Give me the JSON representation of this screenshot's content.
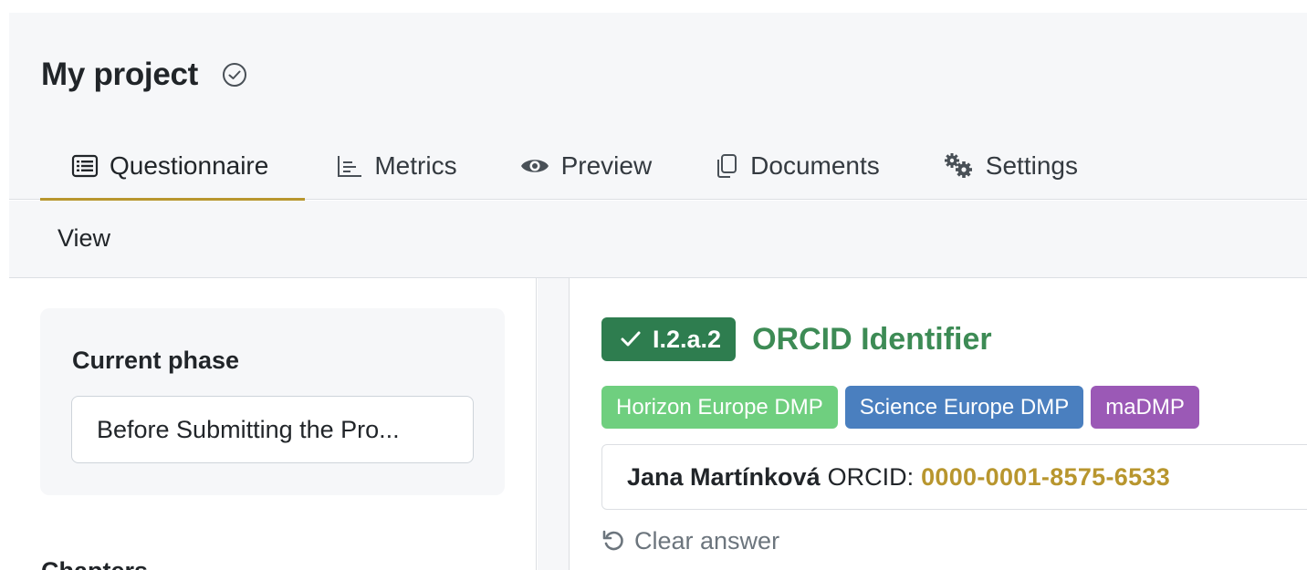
{
  "project": {
    "title": "My project"
  },
  "tabs": [
    {
      "label": "Questionnaire",
      "icon": "list-icon",
      "active": true
    },
    {
      "label": "Metrics",
      "icon": "bar-chart-icon",
      "active": false
    },
    {
      "label": "Preview",
      "icon": "eye-icon",
      "active": false
    },
    {
      "label": "Documents",
      "icon": "documents-icon",
      "active": false
    },
    {
      "label": "Settings",
      "icon": "gears-icon",
      "active": false
    }
  ],
  "subbar": {
    "view_label": "View"
  },
  "sidebar": {
    "phase_title": "Current phase",
    "phase_value": "Before Submitting the Pro...",
    "chapters_heading": "Chapters"
  },
  "question": {
    "number": "I.2.a.2",
    "title": "ORCID Identifier",
    "tags": [
      {
        "label": "Horizon Europe DMP",
        "color": "#6fcf7f"
      },
      {
        "label": "Science Europe DMP",
        "color": "#4a7fbf"
      },
      {
        "label": "maDMP",
        "color": "#9b59b6"
      }
    ],
    "answer": {
      "name": "Jana Martínková",
      "label": "ORCID:",
      "orcid": "0000-0001-8575-6533"
    },
    "clear_label": "Clear answer"
  },
  "colors": {
    "accent": "#b8962e",
    "answered_green": "#2e7d4f",
    "title_green": "#3d8b55"
  }
}
